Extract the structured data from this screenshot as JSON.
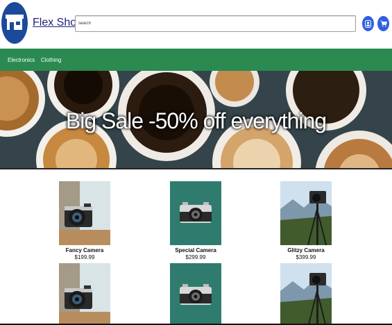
{
  "header": {
    "brand": "Flex Shop",
    "search_value": "search",
    "account_icon": "user-icon",
    "cart_icon": "cart-icon"
  },
  "nav": {
    "items": [
      {
        "label": "Electronics"
      },
      {
        "label": "Clothing"
      }
    ]
  },
  "banner": {
    "title": "Big Sale -50% off everything"
  },
  "products": [
    {
      "name": "Fancy Camera",
      "price": "$199.99"
    },
    {
      "name": "Special Camera",
      "price": "$299.99"
    },
    {
      "name": "Glitzy Camera",
      "price": "$399.99"
    },
    {
      "name": "",
      "price": ""
    },
    {
      "name": "",
      "price": ""
    },
    {
      "name": "",
      "price": ""
    }
  ],
  "colors": {
    "nav_bg": "#2a8a50",
    "brand": "#1f237e",
    "icon_button": "#2f5fe0"
  }
}
